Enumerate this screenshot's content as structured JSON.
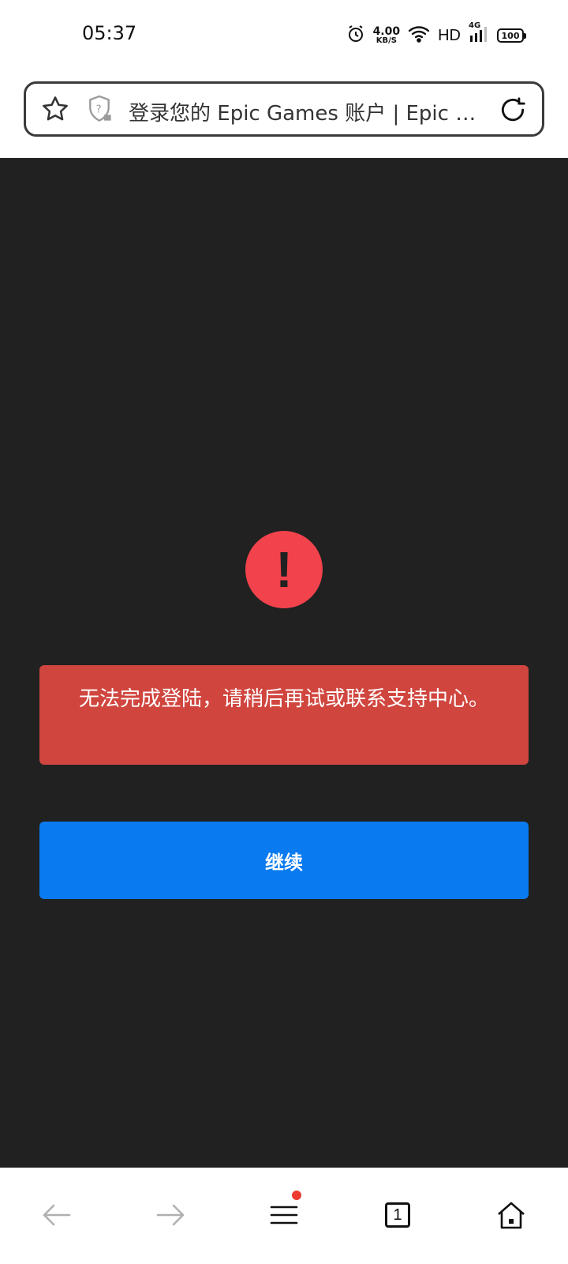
{
  "status_bar": {
    "time": "05:37",
    "net_speed_value": "4.00",
    "net_speed_unit": "KB/S",
    "hd": "HD",
    "signal": "4G",
    "battery": "100"
  },
  "address_bar": {
    "title": "登录您的 Epic Games 账户 | Epic Games"
  },
  "error": {
    "icon_glyph": "!",
    "message": "无法完成登陆，请稍后再试或联系支持中心。"
  },
  "continue_button": {
    "label": "继续"
  },
  "bottom_nav": {
    "tab_count": "1"
  },
  "colors": {
    "background": "#212121",
    "error_icon": "#f2424b",
    "error_box": "#d0463f",
    "primary_button": "#0a7af0",
    "notification_dot": "#ee3b2f"
  }
}
